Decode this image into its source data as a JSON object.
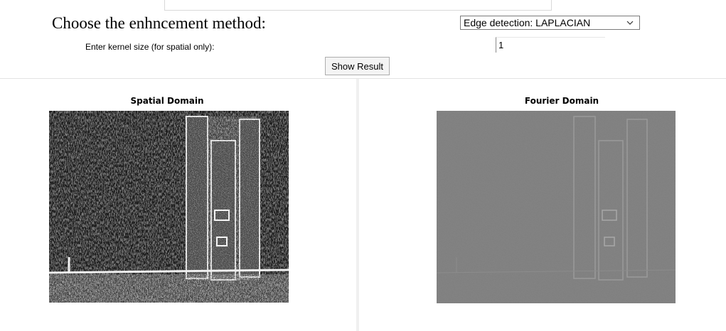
{
  "header": {
    "heading": "Choose the enhncement method:",
    "method_selected": "Edge detection: LAPLACIAN"
  },
  "kernel": {
    "label": "Enter kernel size (for spatial only):",
    "value": "1"
  },
  "actions": {
    "show_result_label": "Show Result"
  },
  "panels": {
    "spatial": {
      "title": "Spatial Domain"
    },
    "fourier": {
      "title": "Fourier Domain"
    }
  },
  "colors": {
    "spatial_bg": "#2e2e2e",
    "fourier_bg": "#7f7f7f"
  }
}
